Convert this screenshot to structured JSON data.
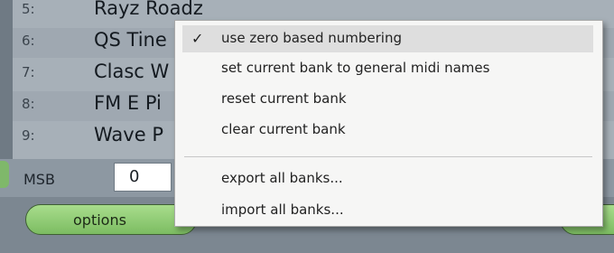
{
  "programs": [
    {
      "num": "5:",
      "name": "Rayz Roadz"
    },
    {
      "num": "6:",
      "name": "QS Tine"
    },
    {
      "num": "7:",
      "name": "Clasc W"
    },
    {
      "num": "8:",
      "name": "FM E Pi"
    },
    {
      "num": "9:",
      "name": "Wave P"
    }
  ],
  "msb": {
    "label": "MSB",
    "value": "0"
  },
  "options_label": "options",
  "menu": {
    "check_glyph": "✓",
    "items": [
      {
        "label": "use zero based numbering",
        "checked": true
      },
      {
        "label": "set current bank to general midi names",
        "checked": false
      },
      {
        "label": "reset current bank",
        "checked": false
      },
      {
        "label": "clear current bank",
        "checked": false
      },
      {
        "label": "export all banks...",
        "checked": false
      },
      {
        "label": "import all banks...",
        "checked": false
      }
    ]
  },
  "icons": {
    "check": "checkmark-icon"
  }
}
